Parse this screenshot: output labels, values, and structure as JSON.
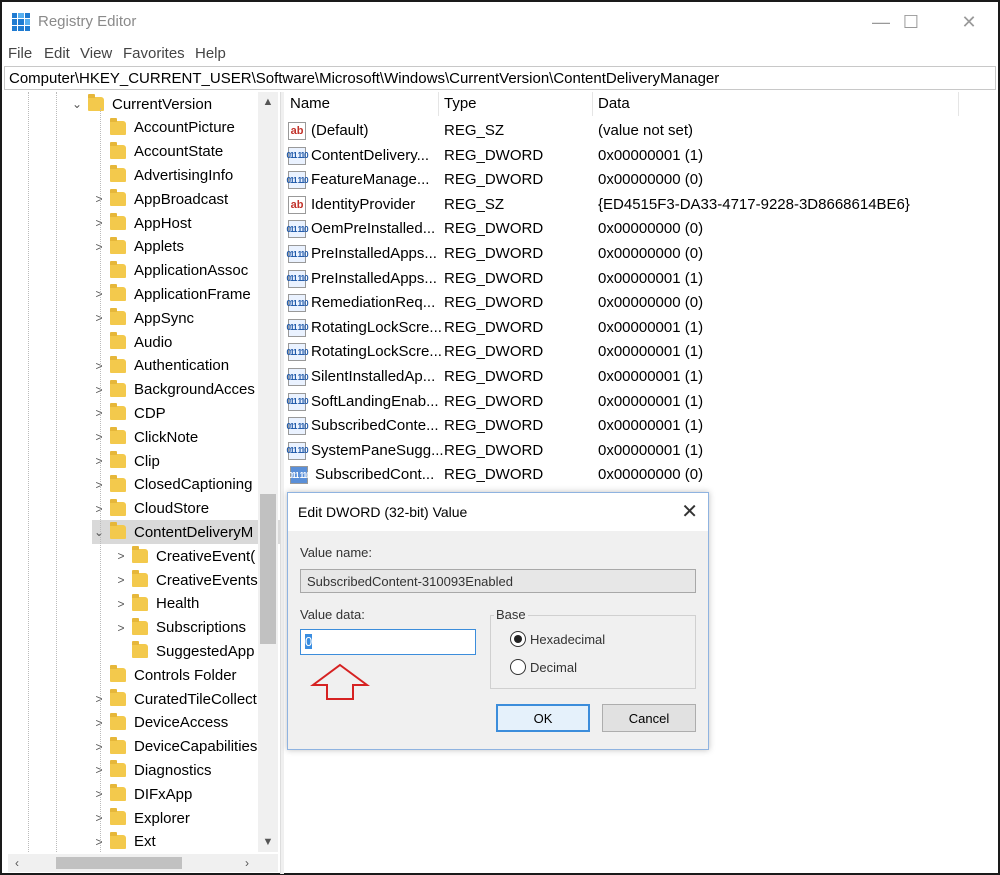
{
  "window": {
    "title": "Registry Editor",
    "minimize_glyph": "—",
    "maximize_glyph": "☐",
    "close_glyph": "✕"
  },
  "menu": [
    "File",
    "Edit",
    "View",
    "Favorites",
    "Help"
  ],
  "address": "Computer\\HKEY_CURRENT_USER\\Software\\Microsoft\\Windows\\CurrentVersion\\ContentDeliveryManager",
  "tree": {
    "root": {
      "label": "CurrentVersion",
      "expander": "⌄"
    },
    "items": [
      {
        "label": "AccountPicture",
        "expander": ""
      },
      {
        "label": "AccountState",
        "expander": ""
      },
      {
        "label": "AdvertisingInfo",
        "expander": ""
      },
      {
        "label": "AppBroadcast",
        "expander": ">"
      },
      {
        "label": "AppHost",
        "expander": ">"
      },
      {
        "label": "Applets",
        "expander": ">"
      },
      {
        "label": "ApplicationAssoc",
        "expander": ""
      },
      {
        "label": "ApplicationFrame",
        "expander": ">"
      },
      {
        "label": "AppSync",
        "expander": ">"
      },
      {
        "label": "Audio",
        "expander": ""
      },
      {
        "label": "Authentication",
        "expander": ">"
      },
      {
        "label": "BackgroundAcces",
        "expander": ">"
      },
      {
        "label": "CDP",
        "expander": ">"
      },
      {
        "label": "ClickNote",
        "expander": ">"
      },
      {
        "label": "Clip",
        "expander": ">"
      },
      {
        "label": "ClosedCaptioning",
        "expander": ">"
      },
      {
        "label": "CloudStore",
        "expander": ">"
      },
      {
        "label": "ContentDeliveryM",
        "expander": "⌄",
        "selected": true
      },
      {
        "label": "Controls Folder",
        "expander": ""
      },
      {
        "label": "CuratedTileCollect",
        "expander": ">"
      },
      {
        "label": "DeviceAccess",
        "expander": ">"
      },
      {
        "label": "DeviceCapabilities",
        "expander": ">"
      },
      {
        "label": "Diagnostics",
        "expander": ">"
      },
      {
        "label": "DIFxApp",
        "expander": ">"
      },
      {
        "label": "Explorer",
        "expander": ">"
      },
      {
        "label": "Ext",
        "expander": ">"
      }
    ],
    "children": [
      {
        "label": "CreativeEvent(",
        "expander": ">"
      },
      {
        "label": "CreativeEvents",
        "expander": ">"
      },
      {
        "label": "Health",
        "expander": ">"
      },
      {
        "label": "Subscriptions",
        "expander": ">"
      },
      {
        "label": "SuggestedApp",
        "expander": ""
      }
    ]
  },
  "columns": {
    "name": "Name",
    "type": "Type",
    "data": "Data"
  },
  "values": [
    {
      "icon": "ab",
      "kind": "sz",
      "name": "(Default)",
      "type": "REG_SZ",
      "data": "(value not set)"
    },
    {
      "icon": "011 110",
      "kind": "dw",
      "name": "ContentDelivery...",
      "type": "REG_DWORD",
      "data": "0x00000001 (1)"
    },
    {
      "icon": "011 110",
      "kind": "dw",
      "name": "FeatureManage...",
      "type": "REG_DWORD",
      "data": "0x00000000 (0)"
    },
    {
      "icon": "ab",
      "kind": "sz",
      "name": "IdentityProvider",
      "type": "REG_SZ",
      "data": "{ED4515F3-DA33-4717-9228-3D8668614BE6}"
    },
    {
      "icon": "011 110",
      "kind": "dw",
      "name": "OemPreInstalled...",
      "type": "REG_DWORD",
      "data": "0x00000000 (0)"
    },
    {
      "icon": "011 110",
      "kind": "dw",
      "name": "PreInstalledApps...",
      "type": "REG_DWORD",
      "data": "0x00000000 (0)"
    },
    {
      "icon": "011 110",
      "kind": "dw",
      "name": "PreInstalledApps...",
      "type": "REG_DWORD",
      "data": "0x00000001 (1)"
    },
    {
      "icon": "011 110",
      "kind": "dw",
      "name": "RemediationReq...",
      "type": "REG_DWORD",
      "data": "0x00000000 (0)"
    },
    {
      "icon": "011 110",
      "kind": "dw",
      "name": "RotatingLockScre...",
      "type": "REG_DWORD",
      "data": "0x00000001 (1)"
    },
    {
      "icon": "011 110",
      "kind": "dw",
      "name": "RotatingLockScre...",
      "type": "REG_DWORD",
      "data": "0x00000001 (1)"
    },
    {
      "icon": "011 110",
      "kind": "dw",
      "name": "SilentInstalledAp...",
      "type": "REG_DWORD",
      "data": "0x00000001 (1)"
    },
    {
      "icon": "011 110",
      "kind": "dw",
      "name": "SoftLandingEnab...",
      "type": "REG_DWORD",
      "data": "0x00000001 (1)"
    },
    {
      "icon": "011 110",
      "kind": "dw",
      "name": "SubscribedConte...",
      "type": "REG_DWORD",
      "data": "0x00000001 (1)"
    },
    {
      "icon": "011 110",
      "kind": "dw",
      "name": "SystemPaneSugg...",
      "type": "REG_DWORD",
      "data": "0x00000001 (1)"
    },
    {
      "icon": "011 110",
      "kind": "dw",
      "name": "SubscribedCont...",
      "type": "REG_DWORD",
      "data": "0x00000000 (0)",
      "selected": true
    }
  ],
  "dialog": {
    "title": "Edit DWORD (32-bit) Value",
    "close_glyph": "✕",
    "value_name_label": "Value name:",
    "value_name": "SubscribedContent-310093Enabled",
    "value_data_label": "Value data:",
    "value_data": "0",
    "base_label": "Base",
    "hex_label": "Hexadecimal",
    "dec_label": "Decimal",
    "ok_label": "OK",
    "cancel_label": "Cancel"
  },
  "colors": {
    "accent": "#3c8ddb",
    "arrow": "#d62222",
    "folder": "#f3c94c"
  }
}
